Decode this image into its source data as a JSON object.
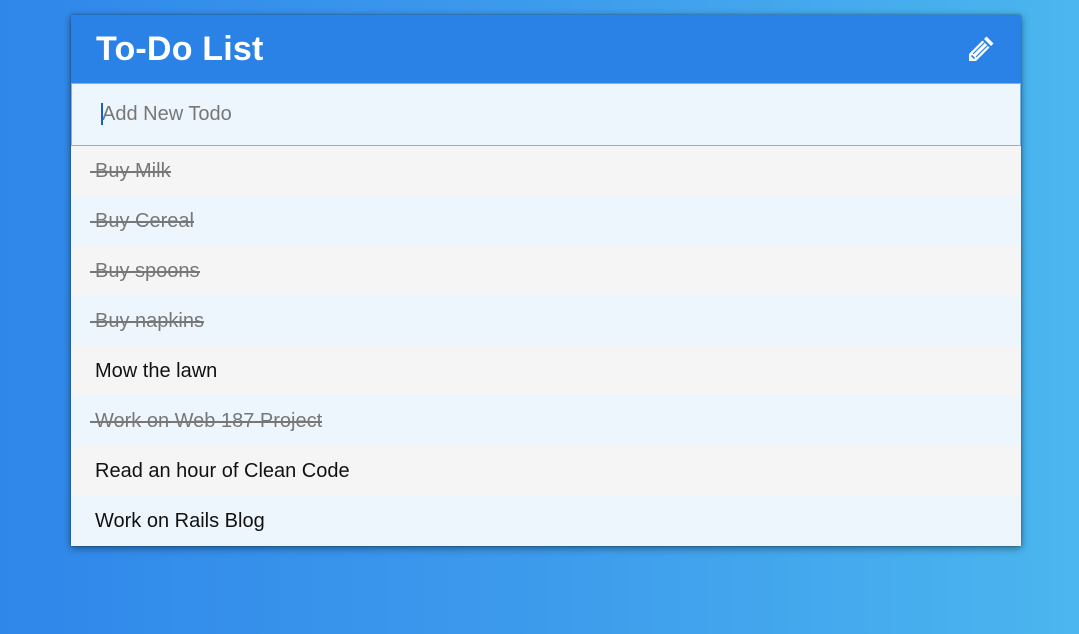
{
  "header": {
    "title": "To-Do List",
    "icon": "pencil-icon"
  },
  "new_todo": {
    "placeholder": "Add New Todo",
    "value": ""
  },
  "todos": [
    {
      "label": "Buy Milk",
      "completed": true
    },
    {
      "label": "Buy Cereal",
      "completed": true
    },
    {
      "label": "Buy spoons",
      "completed": true
    },
    {
      "label": "Buy napkins",
      "completed": true
    },
    {
      "label": "Mow the lawn",
      "completed": false
    },
    {
      "label": "Work on Web 187 Project",
      "completed": true
    },
    {
      "label": "Read an hour of Clean Code",
      "completed": false
    },
    {
      "label": "Work on Rails Blog",
      "completed": false
    }
  ],
  "colors": {
    "header": "#2a82e6",
    "background_start": "#2f87ea",
    "background_end": "#4bb6ef",
    "completed_text": "#777777"
  }
}
